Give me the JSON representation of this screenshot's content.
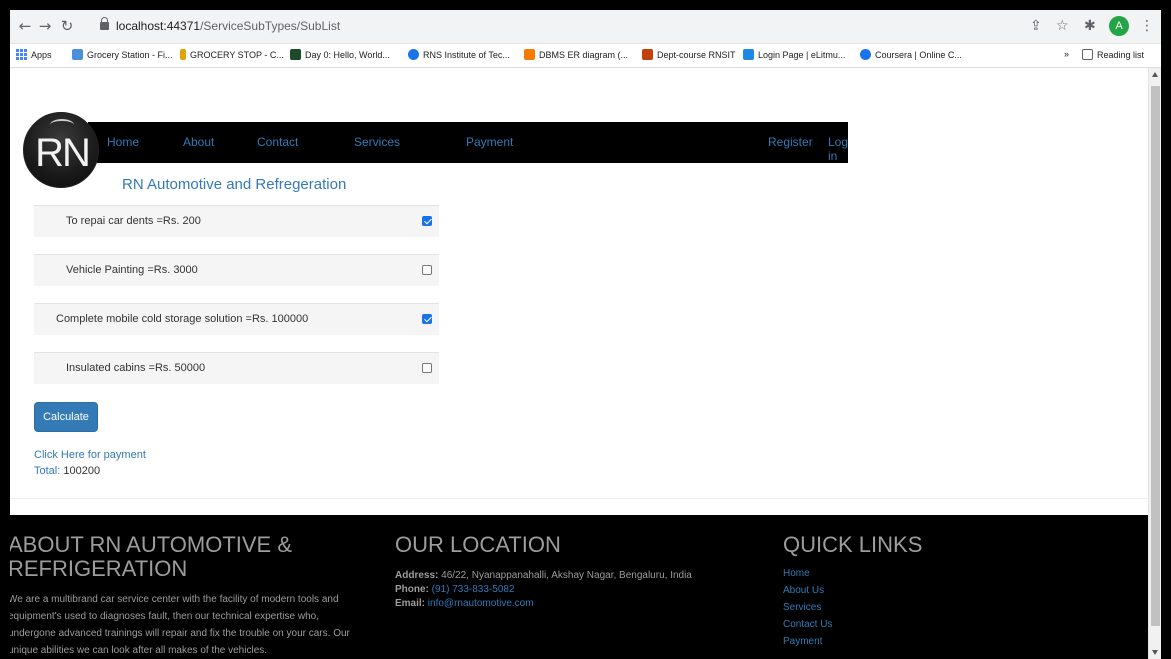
{
  "browser": {
    "url_host": "localhost:44371",
    "url_path": "/ServiceSubTypes/SubList",
    "bookmarks": [
      "Apps",
      "Grocery Station - Fi...",
      "GROCERY STOP - C...",
      "Day 0: Hello, World...",
      "RNS Institute of Tec...",
      "DBMS ER diagram (...",
      "Dept-course RNSIT",
      "Login Page | eLitmu...",
      "Coursera | Online C..."
    ],
    "overflow": "»",
    "reading_list": "Reading list",
    "avatar_letter": "A"
  },
  "nav": {
    "links": [
      "Home",
      "About",
      "Contact",
      "Services",
      "Payment"
    ],
    "register": "Register",
    "login": "Log in"
  },
  "brand": {
    "logo_text": "RN",
    "name": "RN Automotive and Refregeration"
  },
  "services": [
    {
      "label": "To repai car dents =Rs. 200",
      "checked": true
    },
    {
      "label": "Vehicle Painting =Rs. 3000",
      "checked": false
    },
    {
      "label": "Complete mobile cold storage solution =Rs. 100000",
      "checked": true
    },
    {
      "label": "Insulated cabins =Rs. 50000",
      "checked": false
    }
  ],
  "calculate_label": "Calculate",
  "payment_link": "Click Here for payment",
  "total": {
    "label": "Total:",
    "value": "100200"
  },
  "footer": {
    "about": {
      "title_line1": "ABOUT RN AUTOMOTIVE &",
      "title_line2": "REFRIGERATION",
      "text_line1": "We are a multibrand car service center with the facility of modern tools and",
      "text_line2": "equipment's used to diagnoses fault, then our technical expertise who,",
      "text_line3": "undergone advanced trainings will repair and fix the trouble on your cars. Our",
      "text_line4": "unique abilities we can look after all makes of the vehicles."
    },
    "location": {
      "title": "OUR LOCATION",
      "address_label": "Address:",
      "address": "46/22, Nyanappanahalli, Akshay Nagar, Bengaluru, India",
      "phone_label": "Phone:",
      "phone": "(91) 733-833-5082",
      "email_label": "Email:",
      "email": "info@rnautomotive.com"
    },
    "quick_links": {
      "title": "QUICK LINKS",
      "links": [
        "Home",
        "About Us",
        "Services",
        "Contact Us",
        "Payment"
      ]
    }
  }
}
